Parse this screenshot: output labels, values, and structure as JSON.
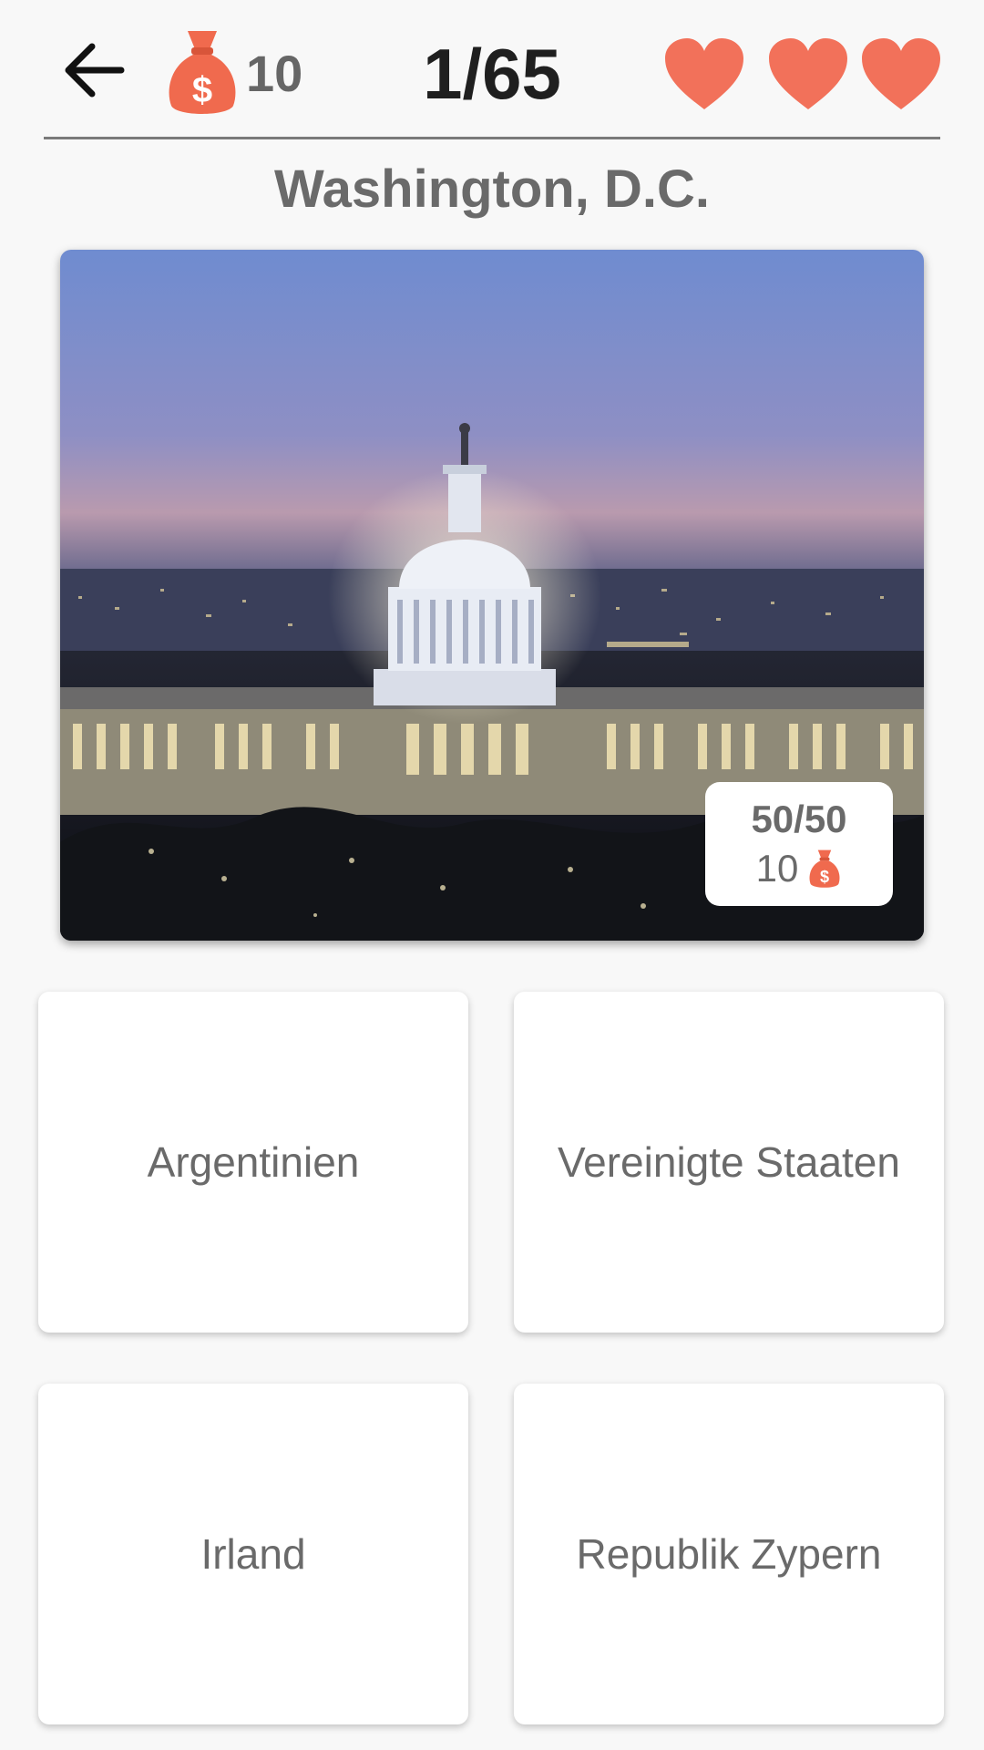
{
  "header": {
    "coins": "10",
    "progress": "1/65",
    "lives": 3
  },
  "question": {
    "city": "Washington, D.C."
  },
  "joker": {
    "label": "50/50",
    "cost": "10"
  },
  "answers": [
    {
      "label": "Argentinien"
    },
    {
      "label": "Vereinigte Staaten"
    },
    {
      "label": "Irland"
    },
    {
      "label": "Republik Zypern"
    }
  ],
  "colors": {
    "heart": "#f2715a",
    "money_bag": "#f06a4e",
    "background": "#f8f8f8"
  },
  "icons": [
    "back-arrow-icon",
    "money-bag-icon",
    "heart-icon"
  ]
}
